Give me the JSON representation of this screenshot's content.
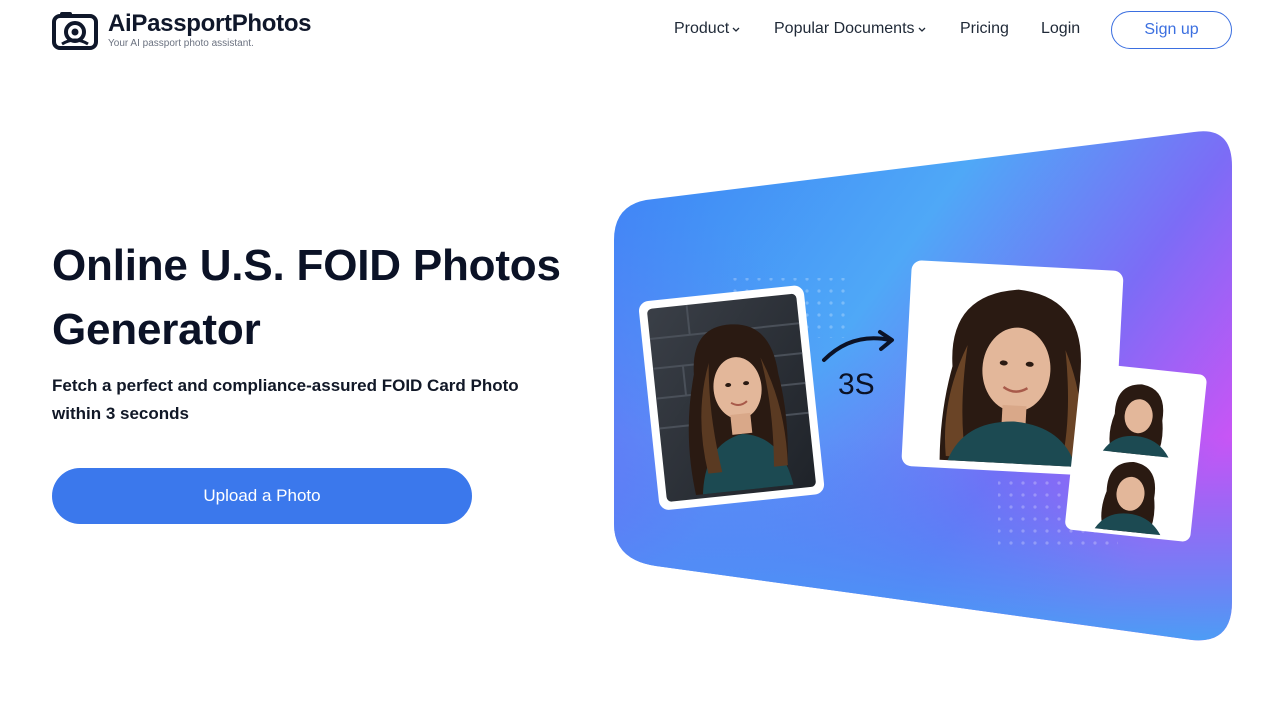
{
  "brand": {
    "name": "AiPassportPhotos",
    "tagline": "Your AI passport photo assistant."
  },
  "nav": {
    "items": [
      {
        "label": "Product",
        "has_dropdown": true
      },
      {
        "label": "Popular Documents",
        "has_dropdown": true
      },
      {
        "label": "Pricing",
        "has_dropdown": false
      },
      {
        "label": "Login",
        "has_dropdown": false
      }
    ],
    "signup_label": "Sign up"
  },
  "hero": {
    "title": "Online U.S. FOID Photos Generator",
    "subtitle": "Fetch a perfect and compliance-assured FOID Card Photo within 3 seconds",
    "upload_label": "Upload a Photo",
    "speed_label": "3S"
  },
  "colors": {
    "primary": "#3b78ec",
    "signup_border": "#3b6fe0",
    "gradient_start": "#3b82f6",
    "gradient_end": "#c055f5",
    "text_dark": "#0b1226"
  },
  "icons": {
    "logo": "camera-face-icon",
    "dropdown": "chevron-down-icon",
    "arrow": "curved-arrow-icon"
  }
}
